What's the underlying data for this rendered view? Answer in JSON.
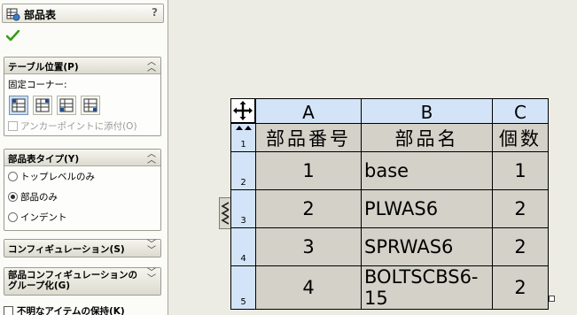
{
  "panel": {
    "title": "部品表",
    "help": "?",
    "groups": {
      "table_position": {
        "title": "テーブル位置(P)",
        "anchor_label": "固定コーナー:",
        "attach_anchor_label": "アンカーポイントに添付(O)"
      },
      "bom_type": {
        "title": "部品表タイプ(Y)",
        "options": [
          "トップレベルのみ",
          "部品のみ",
          "インデント"
        ],
        "selected": "部品のみ"
      },
      "configurations": {
        "title": "コンフィギュレーション(S)"
      },
      "part_config_grouping": {
        "title_line1": "部品コンフィギュレーションの",
        "title_line2": "グループ化(G)"
      },
      "keep_missing": {
        "label": "不明なアイテムの保持(K)"
      }
    },
    "colors": {
      "ok_green": "#3a9a1c",
      "selected_blue": "#cfdff0"
    }
  },
  "bom_table": {
    "columns": [
      "A",
      "B",
      "C"
    ],
    "headers": [
      "部品番号",
      "部品名",
      "個数"
    ],
    "row_numbers": [
      "1",
      "2",
      "3",
      "4",
      "5"
    ],
    "rows": [
      {
        "item_no": "1",
        "part_name": "base",
        "qty": "1"
      },
      {
        "item_no": "2",
        "part_name": "PLWAS6",
        "qty": "2"
      },
      {
        "item_no": "3",
        "part_name": "SPRWAS6",
        "qty": "2"
      },
      {
        "item_no": "4",
        "part_name": "BOLTSCBS6-15",
        "qty": "2"
      }
    ],
    "colors": {
      "header_bg": "#d3e4f9",
      "cell_bg": "#d3d1c8"
    }
  }
}
